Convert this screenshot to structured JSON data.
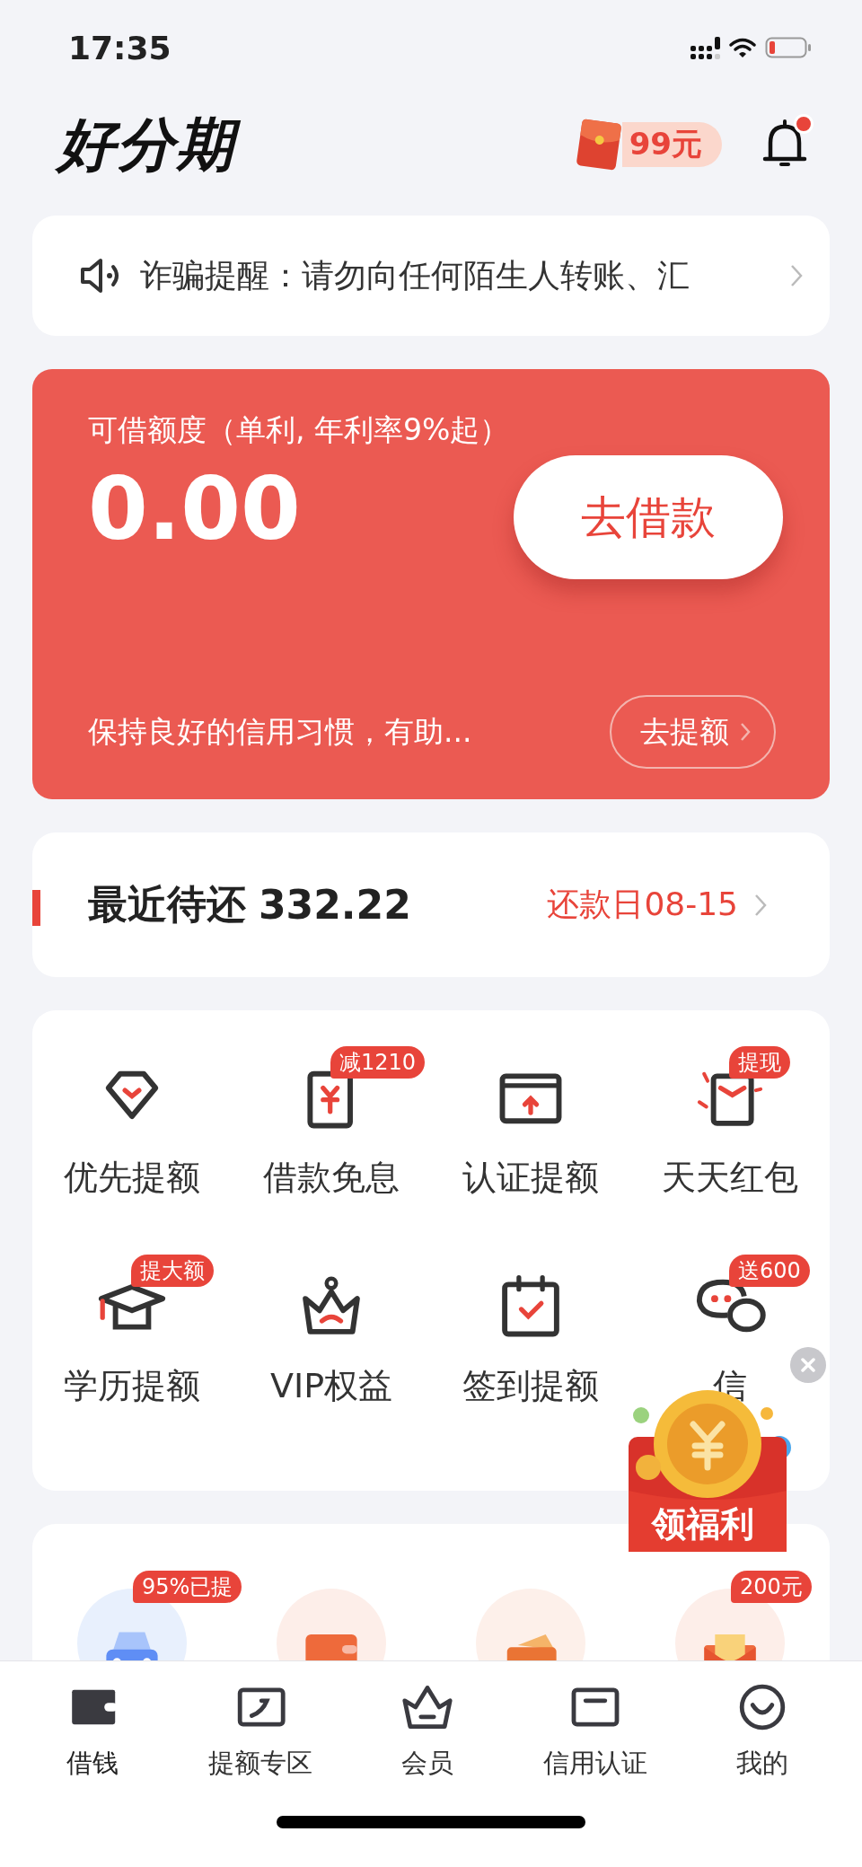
{
  "status_bar": {
    "time": "17:35"
  },
  "header": {
    "logo": "好分期",
    "reward_badge": "99元",
    "notifications_unread": true
  },
  "notice": {
    "text": "诈骗提醒：请勿向任何陌生人转账、汇"
  },
  "credit_card": {
    "label": "可借额度（单利, 年利率9%起）",
    "amount": "0.00",
    "borrow_button": "去借款",
    "hint": "保持良好的信用习惯，有助...",
    "raise_button": "去提额"
  },
  "repayment": {
    "label": "最近待还",
    "amount": "332.22",
    "due": "还款日08-15"
  },
  "services": [
    {
      "kind": "diamond",
      "label": "优先提额"
    },
    {
      "kind": "bill",
      "label": "借款免息",
      "badge": "减1210"
    },
    {
      "kind": "window",
      "label": "认证提额"
    },
    {
      "kind": "envelope",
      "label": "天天红包",
      "badge": "提现"
    },
    {
      "kind": "cap",
      "label": "学历提额",
      "badge": "提大额"
    },
    {
      "kind": "crown",
      "label": "VIP权益"
    },
    {
      "kind": "calendar",
      "label": "签到提额"
    },
    {
      "kind": "chat",
      "label": "信",
      "badge": "送600"
    }
  ],
  "promotions": [
    {
      "kind": "car",
      "badge": "95%已提"
    },
    {
      "kind": "wallet"
    },
    {
      "kind": "card"
    },
    {
      "kind": "envelope",
      "badge": "200元"
    }
  ],
  "promo": {
    "label": "领福利"
  },
  "tab_bar": [
    {
      "kind": "wallet",
      "label": "借钱",
      "selected": true
    },
    {
      "kind": "frame",
      "label": "提额专区",
      "selected": false
    },
    {
      "kind": "crown",
      "label": "会员",
      "selected": false
    },
    {
      "kind": "card",
      "label": "信用认证",
      "selected": false
    },
    {
      "kind": "smile",
      "label": "我的",
      "selected": false
    }
  ]
}
